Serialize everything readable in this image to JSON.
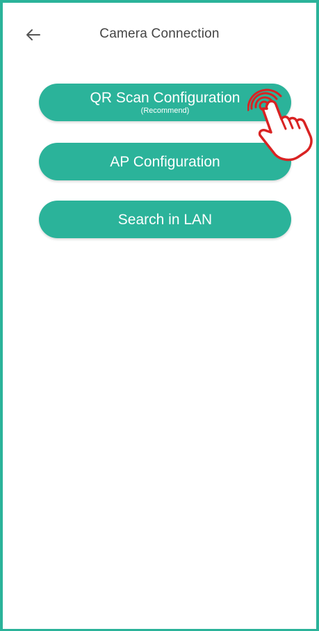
{
  "header": {
    "back_icon": "arrow-left-icon",
    "title": "Camera Connection"
  },
  "buttons": [
    {
      "label": "QR Scan Configuration",
      "sublabel": "(Recommend)"
    },
    {
      "label": "AP Configuration"
    },
    {
      "label": "Search in LAN"
    }
  ],
  "annotation": {
    "icon": "pointing-hand-icon",
    "color": "#d92323"
  },
  "colors": {
    "accent": "#2bb39a",
    "title_text": "#444444"
  }
}
